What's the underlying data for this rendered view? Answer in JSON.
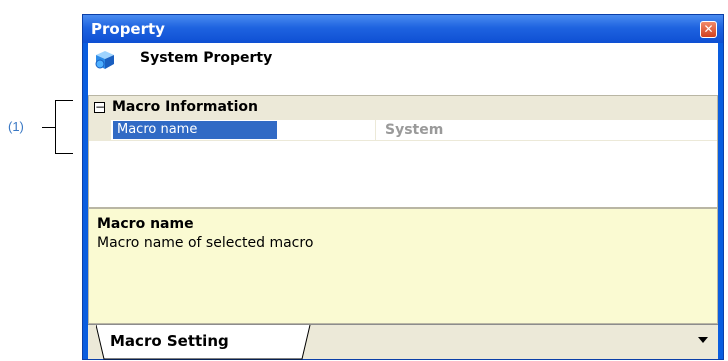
{
  "callout": {
    "label": "(1)"
  },
  "window": {
    "title": "Property",
    "close_icon": "close-icon"
  },
  "header": {
    "title": "System Property",
    "icon": "cube-icon"
  },
  "grid": {
    "category": "Macro Information",
    "rows": [
      {
        "name": "Macro name",
        "value": "System"
      }
    ]
  },
  "description": {
    "title": "Macro name",
    "text": "Macro name of selected macro"
  },
  "tabs": [
    {
      "label": "Macro Setting",
      "selected": true
    }
  ],
  "colors": {
    "title_bar": "#0a5ddf",
    "selection": "#316ac5",
    "description_bg": "#fafad2",
    "grid_category_bg": "#ece9d8",
    "value_text": "#9a9a9a"
  }
}
